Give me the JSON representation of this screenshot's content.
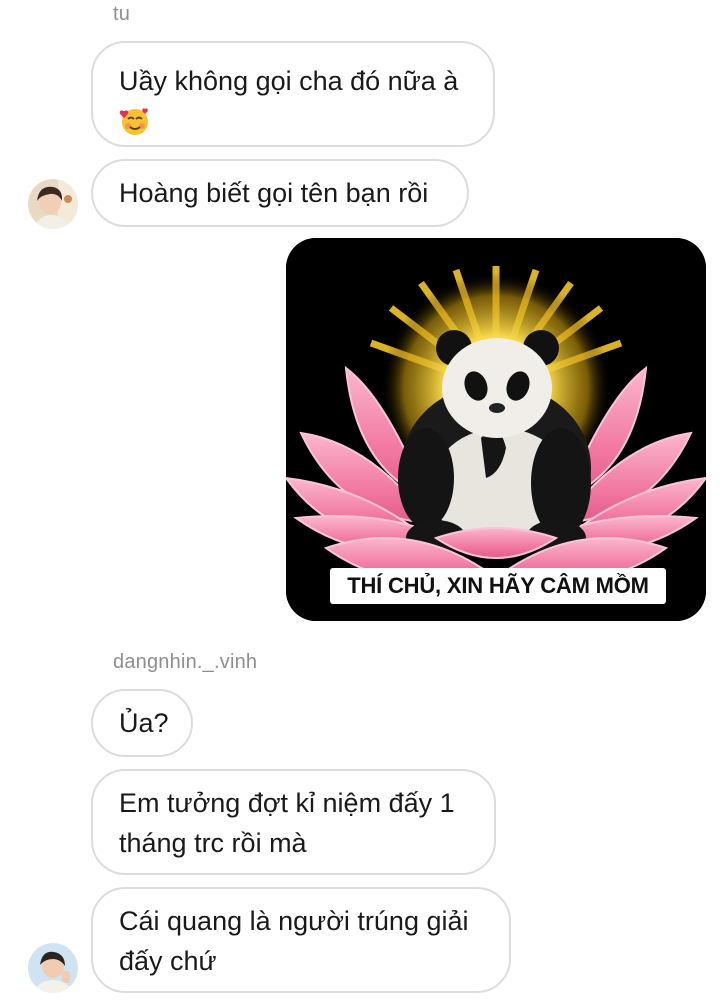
{
  "messages": {
    "group1": {
      "sender": "tu",
      "msg1": "Uầy không gọi cha đó nữa à",
      "msg1_emoji": "smiling-face-with-hearts",
      "msg2": "Hoàng biết gọi tên bạn rồi"
    },
    "sent_image": {
      "caption": "THÍ CHỦ, XIN HÃY CÂM MỒM",
      "description_icon": "panda-on-lotus"
    },
    "group2": {
      "sender": "dangnhin._.vinh",
      "msg1": "Ủa?",
      "msg2_line1": "Em tưởng đợt kỉ niệm đấy 1",
      "msg2_line2": "tháng trc rồi mà",
      "msg3_line1": "Cái quang là người trúng giải",
      "msg3_line2": "đấy chứ"
    }
  },
  "colors": {
    "bubble_border": "#dcdcdc",
    "sender_text": "#8e8e8e",
    "image_background": "#000000",
    "lotus": "#f27aa3"
  }
}
